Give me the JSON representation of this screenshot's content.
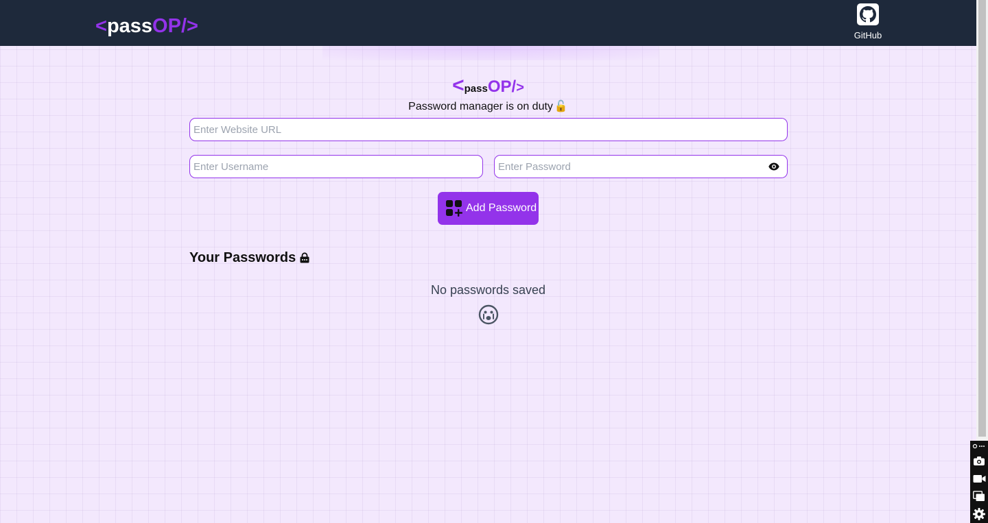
{
  "navbar": {
    "logo": {
      "open": "<",
      "pass": "pass",
      "op": "OP/",
      "close": ">"
    },
    "github_label": "GitHub"
  },
  "hero": {
    "logo": {
      "open": "<",
      "pass": "pass",
      "op": "OP/",
      "close": ">"
    },
    "tagline": "Password manager is on duty",
    "tagline_emoji": "🔓"
  },
  "form": {
    "url_placeholder": "Enter Website URL",
    "url_value": "",
    "username_placeholder": "Enter Username",
    "username_value": "",
    "password_placeholder": "Enter Password",
    "password_value": "",
    "add_button_label": "Add Password"
  },
  "passwords": {
    "title": "Your Passwords",
    "empty_message": "No passwords saved",
    "items": []
  },
  "icons": {
    "github": "github-icon",
    "eye": "eye-icon",
    "add": "add-grid-icon",
    "lock": "lock-icon",
    "empty": "sad-face-icon"
  },
  "colors": {
    "accent": "#9333ea",
    "navbar_bg": "#1e293b",
    "page_bg": "#f3e8fd"
  }
}
